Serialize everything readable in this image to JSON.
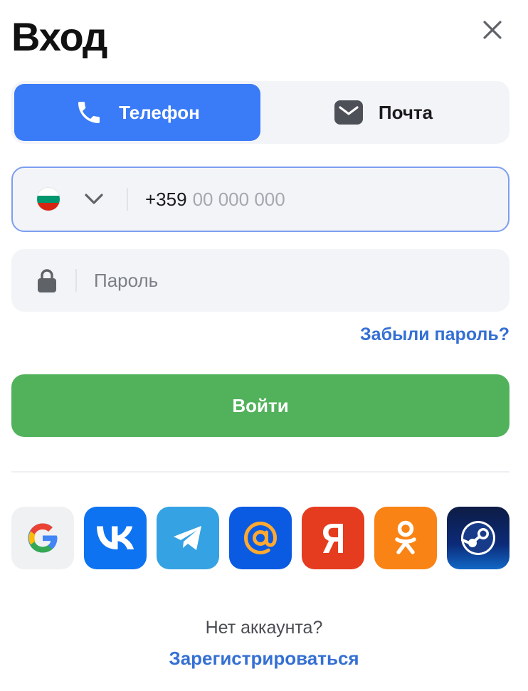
{
  "header": {
    "title": "Вход"
  },
  "tabs": [
    {
      "label": "Телефон",
      "icon": "phone-icon",
      "active": true
    },
    {
      "label": "Почта",
      "icon": "mail-icon",
      "active": false
    }
  ],
  "phone": {
    "country_flag_colors": [
      "#ffffff",
      "#00966e",
      "#d62612"
    ],
    "prefix": "+359",
    "mask": "00 000 000"
  },
  "password": {
    "placeholder": "Пароль"
  },
  "forgot_link": "Забыли пароль?",
  "login_button": "Войти",
  "social_logins": [
    {
      "name": "google-icon"
    },
    {
      "name": "vk-icon"
    },
    {
      "name": "telegram-icon"
    },
    {
      "name": "mailru-icon"
    },
    {
      "name": "yandex-icon"
    },
    {
      "name": "odnoklassniki-icon"
    },
    {
      "name": "steam-icon"
    }
  ],
  "footer": {
    "no_account": "Нет аккаунта?",
    "register_link": "Зарегистрироваться"
  },
  "colors": {
    "accent": "#3a7bf7",
    "primary_button": "#52b25c",
    "link": "#3570d3"
  }
}
